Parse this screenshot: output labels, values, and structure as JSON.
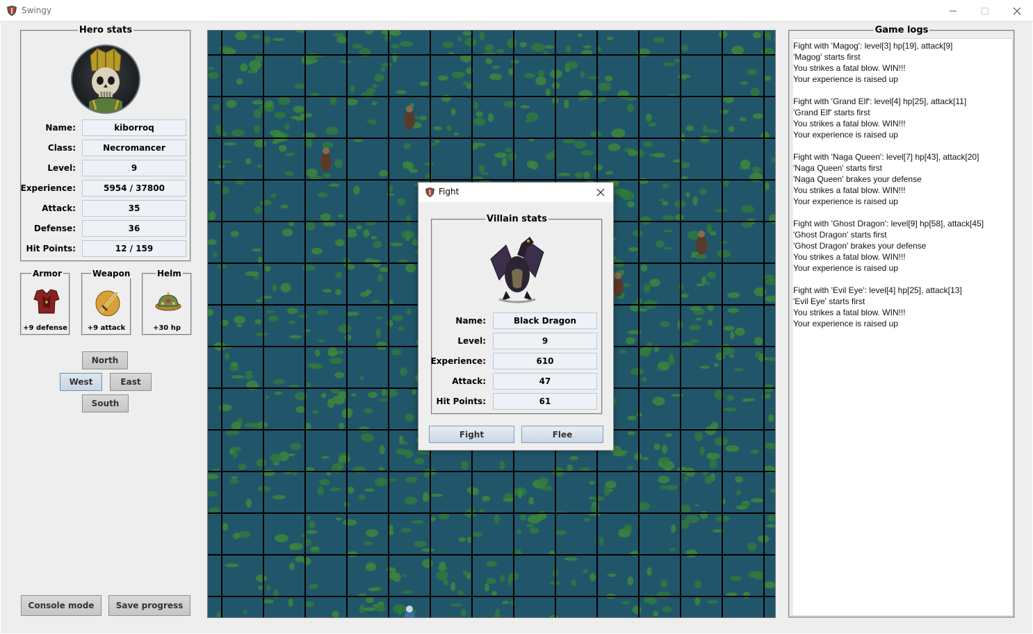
{
  "window": {
    "title": "Swingy"
  },
  "hero": {
    "group_title": "Hero stats",
    "stats": [
      {
        "label": "Name:",
        "value": "kiborroq"
      },
      {
        "label": "Class:",
        "value": "Necromancer"
      },
      {
        "label": "Level:",
        "value": "9"
      },
      {
        "label": "Experience:",
        "value": "5954 / 37800"
      },
      {
        "label": "Attack:",
        "value": "35"
      },
      {
        "label": "Defense:",
        "value": "36"
      },
      {
        "label": "Hit Points:",
        "value": "12 / 159"
      }
    ]
  },
  "equipment": {
    "armor": {
      "title": "Armor",
      "bonus": "+9 defense"
    },
    "weapon": {
      "title": "Weapon",
      "bonus": "+9 attack"
    },
    "helm": {
      "title": "Helm",
      "bonus": "+30 hp"
    }
  },
  "movement": {
    "north": "North",
    "west": "West",
    "east": "East",
    "south": "South"
  },
  "footer": {
    "console_mode": "Console mode",
    "save_progress": "Save progress"
  },
  "dialog": {
    "title": "Fight",
    "group_title": "Villain stats",
    "stats": [
      {
        "label": "Name:",
        "value": "Black Dragon"
      },
      {
        "label": "Level:",
        "value": "9"
      },
      {
        "label": "Experience:",
        "value": "610"
      },
      {
        "label": "Attack:",
        "value": "47"
      },
      {
        "label": "Hit Points:",
        "value": "61"
      }
    ],
    "fight_button": "Fight",
    "flee_button": "Flee"
  },
  "logs": {
    "group_title": "Game logs",
    "lines": [
      "Fight with 'Magog': level[3] hp[19], attack[9]",
      "'Magog' starts first",
      "You strikes a fatal blow. WIN!!!",
      "Your experience is raised up",
      "",
      "Fight with 'Grand Elf': level[4] hp[25], attack[11]",
      "'Grand Elf' starts first",
      "You strikes a fatal blow. WIN!!!",
      "Your experience is raised up",
      "",
      "Fight with 'Naga Queen': level[7] hp[43], attack[20]",
      "'Naga Queen' starts first",
      "'Naga Queen' brakes your defense",
      "You strikes a fatal blow. WIN!!!",
      "Your experience is raised up",
      "",
      "Fight with 'Ghost Dragon': level[9] hp[58], attack[45]",
      "'Ghost Dragon' starts first",
      "'Ghost Dragon' brakes your defense",
      "You strikes a fatal blow. WIN!!!",
      "Your experience is raised up",
      "",
      "Fight with 'Evil Eye': level[4] hp[25], attack[13]",
      "'Evil Eye' starts first",
      "You strikes a fatal blow. WIN!!!",
      "Your experience is raised up"
    ]
  },
  "map": {
    "columns": 14,
    "rows": 14,
    "tile_color": "#2f6b3e",
    "grid_color": "#000000",
    "units": [
      {
        "name": "villain-unit",
        "col": 4,
        "row": 2
      },
      {
        "name": "villain-unit",
        "col": 2,
        "row": 3
      },
      {
        "name": "villain-unit",
        "col": 11,
        "row": 5
      },
      {
        "name": "villain-unit",
        "col": 9,
        "row": 6
      },
      {
        "name": "hero-unit",
        "col": 4,
        "row": 14
      }
    ]
  }
}
